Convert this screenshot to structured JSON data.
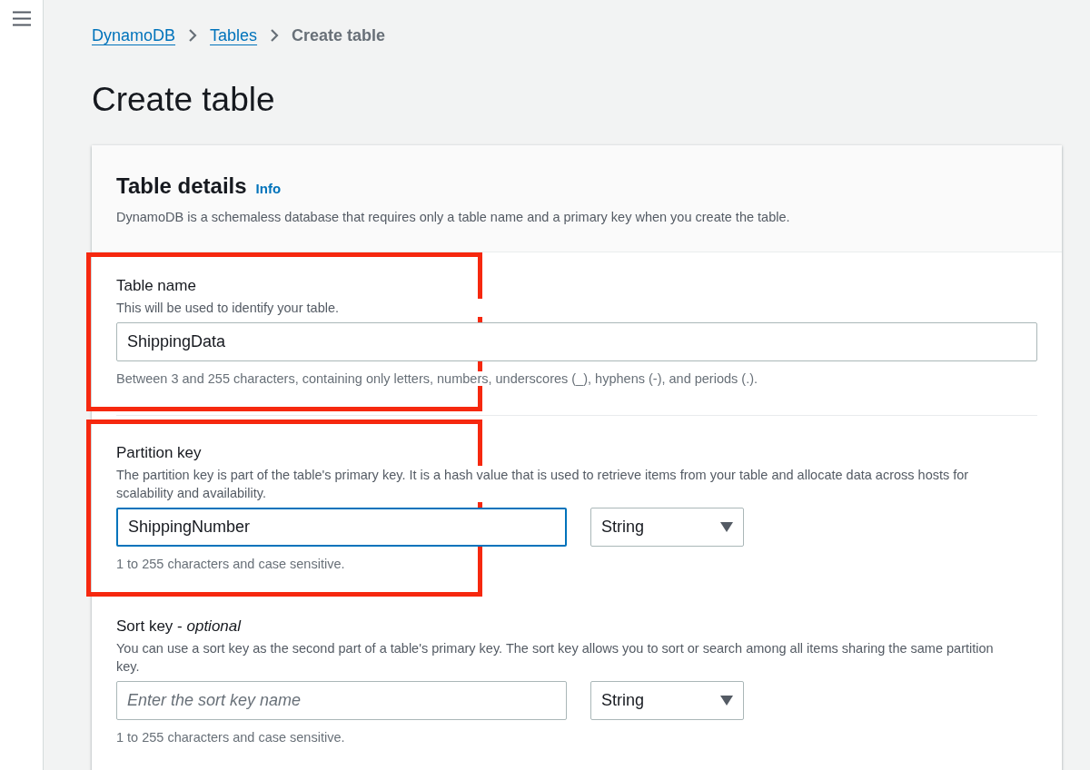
{
  "breadcrumbs": [
    {
      "label": "DynamoDB",
      "kind": "link"
    },
    {
      "label": "Tables",
      "kind": "link"
    },
    {
      "label": "Create table",
      "kind": "current"
    }
  ],
  "page_title": "Create table",
  "table_details": {
    "title": "Table details",
    "info_link": "Info",
    "description": "DynamoDB is a schemaless database that requires only a table name and a primary key when you create the table.",
    "fields": [
      {
        "kind": "name",
        "label": "Table name",
        "description": "This will be used to identify your table.",
        "value": "ShippingData",
        "focused": false,
        "highlighted": true,
        "constraint": "Between 3 and 255 characters, containing only letters, numbers, underscores (_), hyphens (-), and periods (.)."
      },
      {
        "kind": "key",
        "label": "Partition key",
        "description": "The partition key is part of the table's primary key. It is a hash value that is used to retrieve items from your table and allocate data across hosts for scalability and availability.",
        "value": "ShippingNumber",
        "focused": true,
        "highlighted": true,
        "type": "String",
        "constraint": "1 to 255 characters and case sensitive."
      },
      {
        "kind": "key",
        "label": "Sort key - *optional*",
        "description": "You can use a sort key as the second part of a table's primary key. The sort key allows you to sort or search among all items sharing the same partition key.",
        "placeholder": "Enter the sort key name",
        "focused": false,
        "highlighted": false,
        "type": "String",
        "constraint": "1 to 255 characters and case sensitive."
      }
    ]
  }
}
